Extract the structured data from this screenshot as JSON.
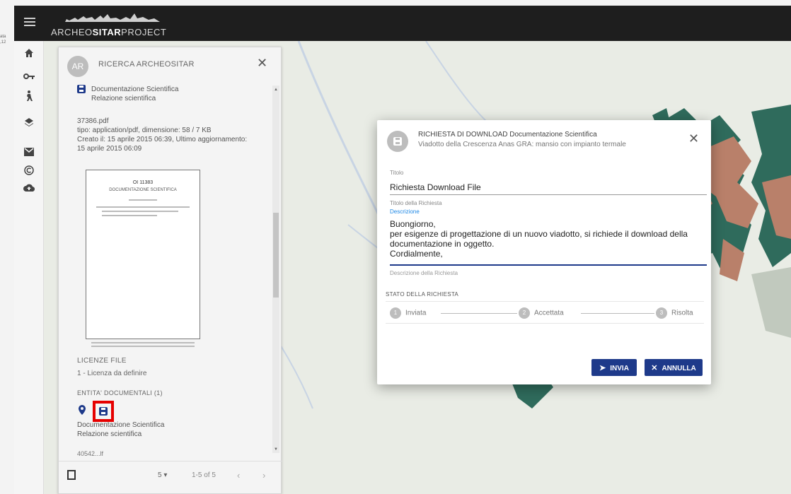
{
  "app": {
    "logo_prefix": "ARCHEO",
    "logo_strong": "SITAR",
    "logo_suffix": "PROJECT"
  },
  "desktop": {
    "side_text": "ata\n,12"
  },
  "rail": {
    "icons": [
      "home-icon",
      "key-icon",
      "person-walking-icon",
      "layers-icon",
      "mail-icon",
      "copyright-icon",
      "cloud-upload-icon"
    ]
  },
  "panel": {
    "avatar": "AR",
    "title": "RICERCA ARCHEOSITAR",
    "doc_title": "Documentazione Scientifica",
    "doc_subtitle": "Relazione scientifica",
    "file_name": "37386.pdf",
    "file_info": "tipo: application/pdf, dimensione: 58 / 7 KB",
    "created": "Creato il: 15 aprile 2015 06:39, Ultimo aggiornamento:",
    "updated": "15 aprile 2015 06:09",
    "thumb_title": "OI 11383",
    "thumb_subtitle": "DOCUMENTAZIONE SCIENTIFICA",
    "license_head": "LICENZE FILE",
    "license_value": "1 - Licenza da definire",
    "related_head": "ENTITA' DOCUMENTALI (1)",
    "related_title": "Documentazione Scientifica",
    "related_subtitle": "Relazione scientifica",
    "next_item": "40542...lf",
    "per_page": "5 ▾",
    "range": "1-5 of 5",
    "prev": "‹",
    "next": "›"
  },
  "dialog": {
    "title_line1": "RICHIESTA DI DOWNLOAD Documentazione Scientifica",
    "title_line2": "Viadotto della Crescenza Anas GRA: mansio con impianto termale",
    "title_field_label": "Titolo",
    "title_field_value": "Richiesta Download File",
    "title_field_hint": "Titolo della Richiesta",
    "desc_label": "Descrizione",
    "desc_value": "Buongiorno,\nper esigenze di progettazione di un nuovo viadotto, si richiede il download della documentazione in oggetto.\nCordialmente,",
    "desc_hint": "Descrizione della Richiesta",
    "status_head": "STATO DELLA RICHIESTA",
    "steps": [
      {
        "num": "1",
        "label": "Inviata"
      },
      {
        "num": "2",
        "label": "Accettata"
      },
      {
        "num": "3",
        "label": "Risolta"
      }
    ],
    "send_label": "INVIA",
    "cancel_label": "ANNULLA"
  },
  "colors": {
    "accent": "#1e3a8a",
    "highlight": "#e60000",
    "topbar": "#1e1e1e",
    "map_bg": "#e9ece5",
    "building_red": "#b9806a",
    "building_green": "#2f6b5c"
  }
}
